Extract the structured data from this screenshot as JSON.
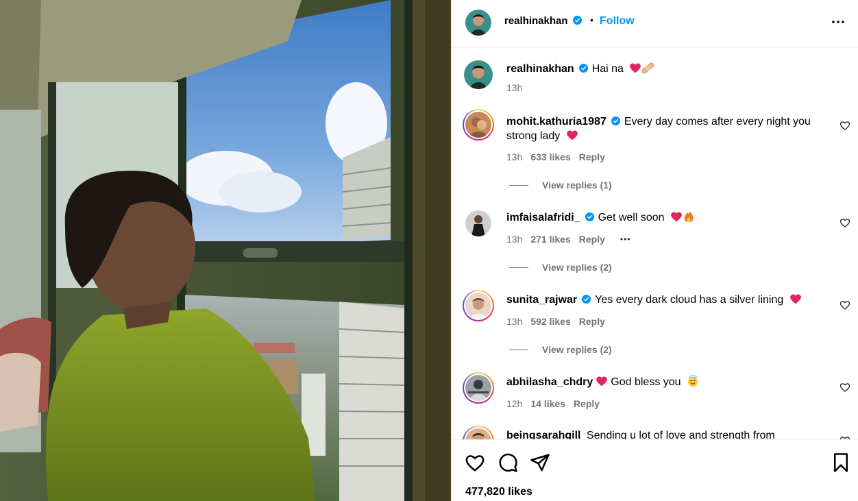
{
  "post": {
    "username": "realhinakhan",
    "follow_label": "Follow",
    "separator": "•"
  },
  "caption": {
    "username": "realhinakhan",
    "text": "Hai na",
    "time": "13h"
  },
  "comments": [
    {
      "username": "mohit.kathuria1987",
      "verified": true,
      "text": "Every day comes after every night you strong lady",
      "emojis": [
        "red-heart"
      ],
      "time": "13h",
      "likes": "633 likes",
      "reply_label": "Reply",
      "view_replies": "View replies (1)"
    },
    {
      "username": "imfaisalafridi_",
      "verified": true,
      "text": "Get well soon",
      "emojis": [
        "red-heart",
        "fire"
      ],
      "time": "13h",
      "likes": "271 likes",
      "reply_label": "Reply",
      "more": "•••",
      "view_replies": "View replies (2)"
    },
    {
      "username": "sunita_rajwar",
      "verified": true,
      "text": "Yes every dark cloud has a silver lining",
      "emojis": [
        "red-heart"
      ],
      "time": "13h",
      "likes": "592 likes",
      "reply_label": "Reply",
      "view_replies": "View replies (2)"
    },
    {
      "username": "abhilasha_chdry",
      "verified": false,
      "text": "God bless you",
      "emojis": [
        "red-heart",
        "smiling-face-with-halo"
      ],
      "time": "12h",
      "likes": "14 likes",
      "reply_label": "Reply"
    },
    {
      "username": "beingsarahgill",
      "verified": false,
      "text": "Sending u lot of love and strength from"
    }
  ],
  "footer": {
    "likes": "477,820 likes"
  },
  "colors": {
    "link_blue": "#0095f6",
    "secondary_text": "#737373",
    "divider": "#efefef",
    "heart_red": "#e0245e",
    "verified_blue": "#0095f6"
  },
  "icons": {
    "header_more": "more-horizontal-icon",
    "like": "heart-outline-icon",
    "comment": "comment-bubble-icon",
    "share": "paper-plane-icon",
    "save": "bookmark-icon"
  }
}
